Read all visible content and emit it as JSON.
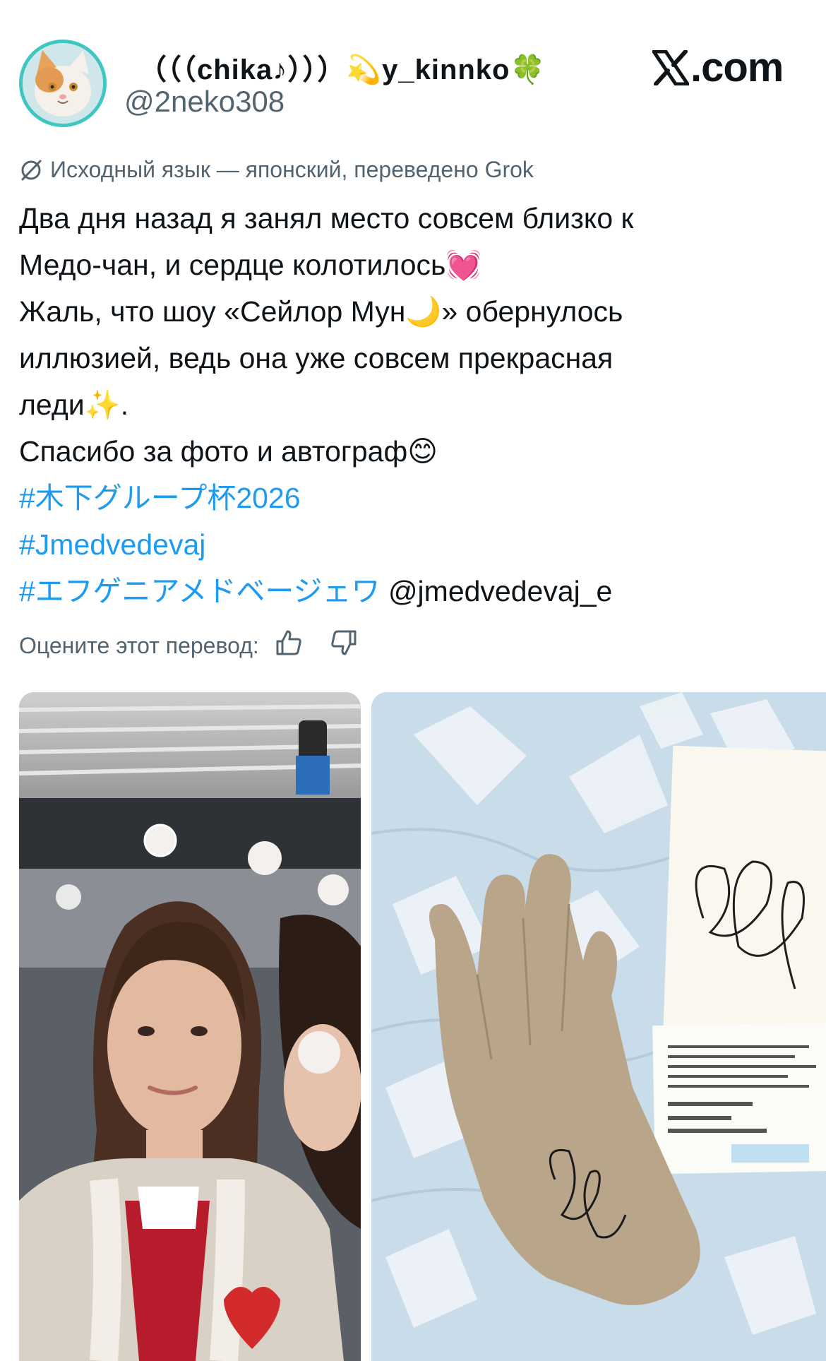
{
  "author": {
    "display_name": "（（（chika♪）））💫y_kinnko🍀",
    "handle": "@2neko308",
    "avatar_icon": "cat-avatar-icon"
  },
  "watermark": {
    "text": ".com",
    "icon": "x-logo-icon"
  },
  "translation": {
    "note": "Исходный язык — японский, переведено Grok",
    "icon": "translate-off-icon"
  },
  "post": {
    "lines": [
      "Два дня назад я занял место совсем близко к",
      "Медо-чан, и сердце колотилось💓",
      "Жаль, что шоу «Сейлор Мун🌙» обернулось",
      "иллюзией, ведь она уже совсем прекрасная",
      "леди✨.",
      "Спасибо за фото и автограф😊"
    ],
    "hashtags": [
      "#木下グループ杯2026",
      "#Jmedvedevaj",
      "#エフゲニアメドベージェワ"
    ],
    "mention": "@jmedvedevaj_e"
  },
  "rating": {
    "label": "Оцените этот перевод:",
    "thumbs_up_icon": "thumbs-up-icon",
    "thumbs_down_icon": "thumbs-down-icon"
  },
  "media": [
    {
      "name": "selfie-photo"
    },
    {
      "name": "signed-glove-photo"
    }
  ],
  "colors": {
    "link": "#1d9bf0",
    "secondary_text": "#536471",
    "avatar_ring": "#3fc6c0"
  }
}
